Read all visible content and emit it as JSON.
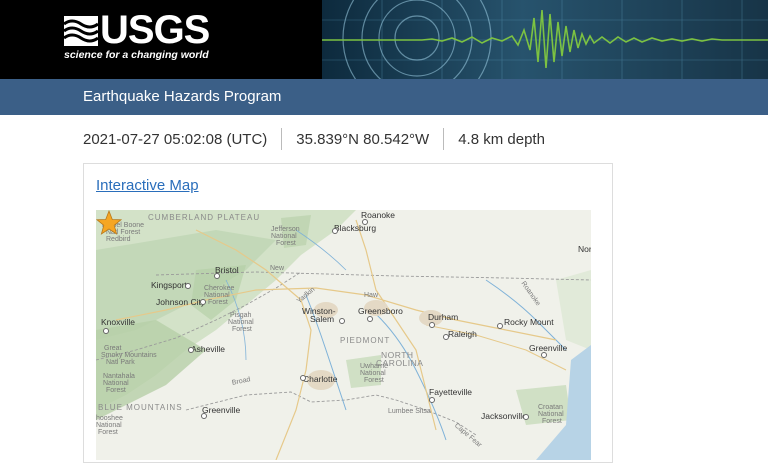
{
  "header": {
    "logo_text": "USGS",
    "logo_tagline": "science for a changing world",
    "program_title": "Earthquake Hazards Program"
  },
  "event": {
    "time": "2021-07-27 05:02:08 (UTC)",
    "location": "35.839°N 80.542°W",
    "depth": "4.8 km depth"
  },
  "map_card": {
    "link_label": "Interactive Map"
  },
  "map": {
    "labels": {
      "cumberland": "CUMBERLAND PLATEAU",
      "daniel_boone": "Daniel Boone",
      "nat_forest1": "Natl Forest",
      "redbird": "Redbird",
      "jefferson": "Jefferson",
      "national": "National",
      "forest": "Forest",
      "roanoke": "Roanoke",
      "blacksburg": "Blacksburg",
      "nor": "Nor",
      "bristol": "Bristol",
      "kingsport": "Kingsport",
      "cherokee": "Cherokee",
      "johnson_city": "Johnson City",
      "pisgah": "Pisgah",
      "knoxville": "Knoxville",
      "great_smoky": "Great",
      "smoky_mountains": "Smoky Mountains",
      "nat_park": "Natl Park",
      "nantahala": "Nantahala",
      "asheville": "Asheville",
      "winston_salem1": "Winston-",
      "winston_salem2": "Salem",
      "greensboro": "Greensboro",
      "durham": "Durham",
      "rocky_mount": "Rocky Mount",
      "raleigh": "Raleigh",
      "piedmont": "PIEDMONT",
      "north": "NORTH",
      "carolina": "CAROLINA",
      "greenville_nc": "Greenville",
      "charlotte": "Charlotte",
      "uwharrie": "Uwharrie",
      "fayetteville": "Fayetteville",
      "blue_mountains": "BLUE MOUNTAINS",
      "greenville_sc": "Greenville",
      "lumbee": "Lumbee Sitsa",
      "jacksonville": "Jacksonville",
      "croatan": "Croatan",
      "roanoke_river": "Roanoke",
      "new_river": "New",
      "yadkin": "Yadkin",
      "haw": "Haw",
      "cape_fear": "Cape Fear",
      "broad": "Broad",
      "chooshee": "hooshee"
    }
  },
  "colors": {
    "banner": "#000000",
    "program_bar": "#3b5f87",
    "link": "#2a6ebb",
    "epicenter": "#f5a623"
  },
  "icons": {
    "epicenter": "star-icon"
  }
}
